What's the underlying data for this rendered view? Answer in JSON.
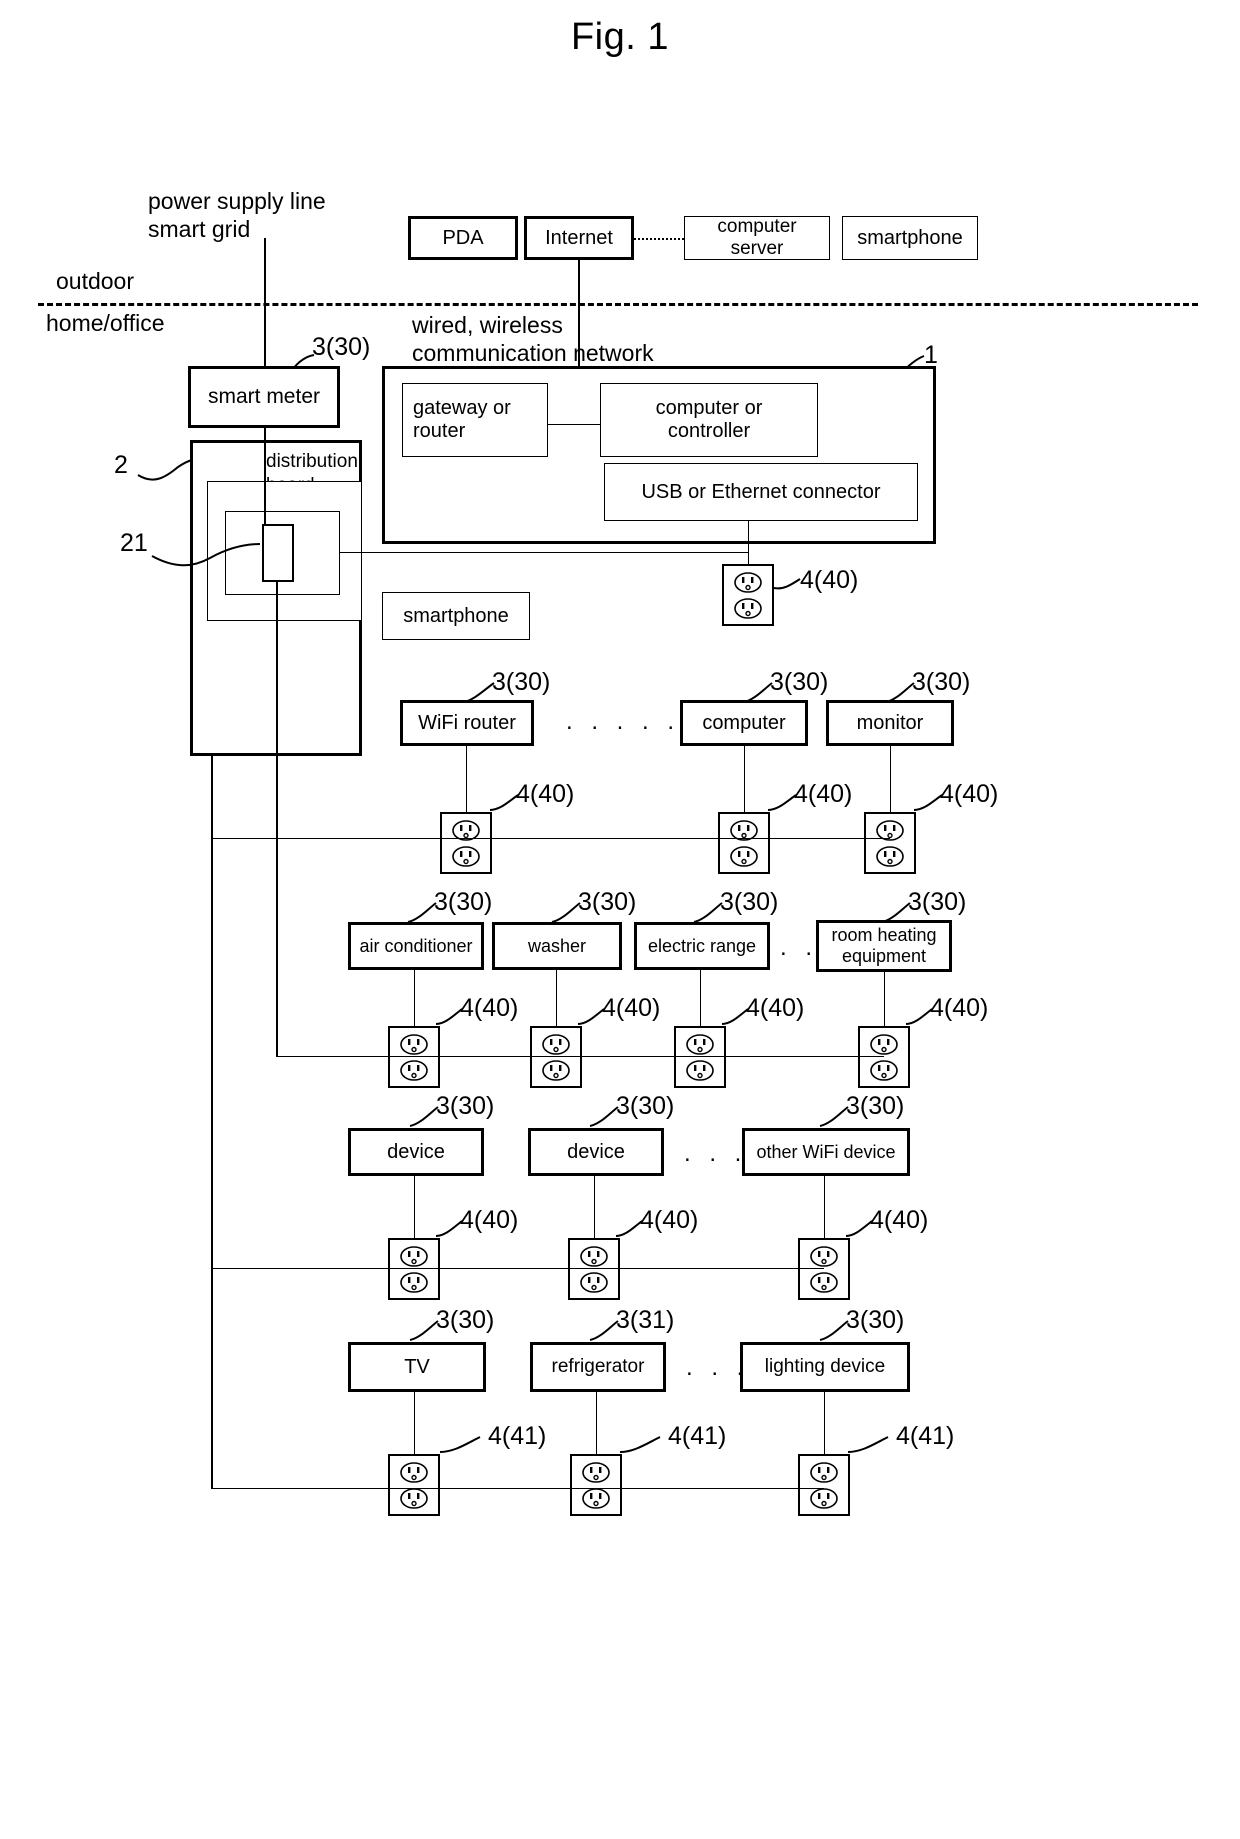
{
  "figure": {
    "title": "Fig. 1"
  },
  "zones": {
    "outdoor": "outdoor",
    "indoor": "home/office"
  },
  "annotations": {
    "power_supply_line": "power supply line\nsmart grid",
    "network": "wired, wireless\ncommunication network",
    "ref_1": "1",
    "ref_2": "2",
    "ref_21": "21",
    "ref_3_30": "3(30)",
    "ref_3_31": "3(31)",
    "ref_4_40": "4(40)",
    "ref_4_41": "4(41)",
    "ellipsis_long": ". . . . . .",
    "ellipsis_med": ". . .",
    "ellipsis_short": ". . ."
  },
  "external": {
    "pda": "PDA",
    "internet": "Internet",
    "computer_server": "computer server",
    "smartphone": "smartphone"
  },
  "meter": {
    "smart_meter": "smart meter",
    "distribution_board": "distribution\nboard"
  },
  "controller_unit": {
    "gateway": "gateway or\nrouter",
    "computer": "computer or\ncontroller",
    "connector": "USB or Ethernet connector"
  },
  "standalone": {
    "smartphone": "smartphone"
  },
  "rows": [
    {
      "id": "row-network",
      "devices": [
        {
          "label": "WiFi router",
          "ref": "3(30)",
          "outlet_ref": "4(40)"
        },
        {
          "label": "computer",
          "ref": "3(30)",
          "outlet_ref": "4(40)"
        },
        {
          "label": "monitor",
          "ref": "3(30)",
          "outlet_ref": "4(40)"
        }
      ]
    },
    {
      "id": "row-appliance",
      "devices": [
        {
          "label": "air conditioner",
          "ref": "3(30)",
          "outlet_ref": "4(40)"
        },
        {
          "label": "washer",
          "ref": "3(30)",
          "outlet_ref": "4(40)"
        },
        {
          "label": "electric range",
          "ref": "3(30)",
          "outlet_ref": "4(40)"
        },
        {
          "label": "room heating\nequipment",
          "ref": "3(30)",
          "outlet_ref": "4(40)"
        }
      ]
    },
    {
      "id": "row-device",
      "devices": [
        {
          "label": "device",
          "ref": "3(30)",
          "outlet_ref": "4(40)"
        },
        {
          "label": "device",
          "ref": "3(30)",
          "outlet_ref": "4(40)"
        },
        {
          "label": "other WiFi device",
          "ref": "3(30)",
          "outlet_ref": "4(40)"
        }
      ]
    },
    {
      "id": "row-home",
      "devices": [
        {
          "label": "TV",
          "ref": "3(30)",
          "outlet_ref": "4(41)"
        },
        {
          "label": "refrigerator",
          "ref": "3(31)",
          "outlet_ref": "4(41)"
        },
        {
          "label": "lighting device",
          "ref": "3(30)",
          "outlet_ref": "4(41)"
        }
      ]
    }
  ],
  "icons": {
    "outlet": "power-outlet-icon"
  }
}
